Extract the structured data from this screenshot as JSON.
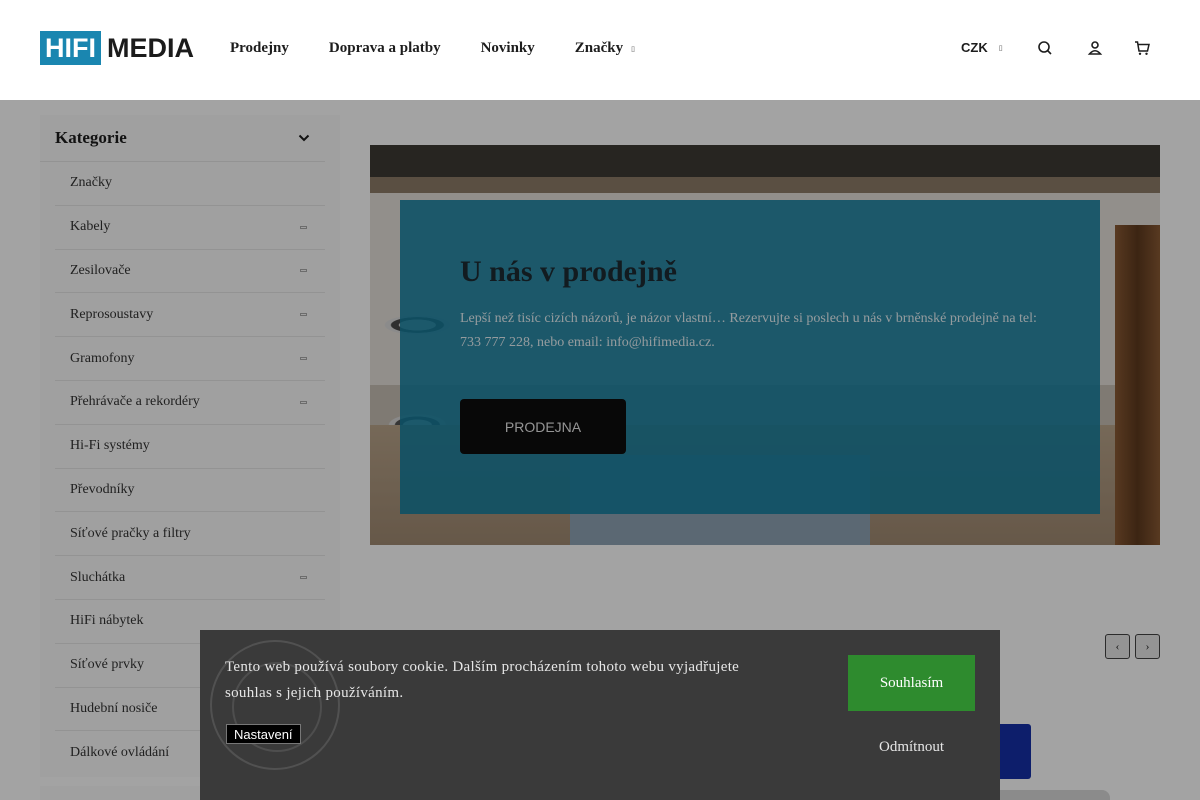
{
  "header": {
    "logo": {
      "box_text": "HIFI",
      "text": "MEDIA"
    },
    "nav": [
      {
        "label": "Prodejny"
      },
      {
        "label": "Doprava a platby"
      },
      {
        "label": "Novinky"
      },
      {
        "label": "Značky",
        "has_dropdown": true
      }
    ],
    "currency": "CZK",
    "icons": [
      "search-icon",
      "user-icon",
      "cart-icon"
    ]
  },
  "sidebar": {
    "title": "Kategorie",
    "items": [
      {
        "label": "Značky",
        "expandable": false
      },
      {
        "label": "Kabely",
        "expandable": true
      },
      {
        "label": "Zesilovače",
        "expandable": true
      },
      {
        "label": "Reprosoustavy",
        "expandable": true
      },
      {
        "label": "Gramofony",
        "expandable": true
      },
      {
        "label": "Přehrávače a rekordéry",
        "expandable": true
      },
      {
        "label": "Hi-Fi systémy",
        "expandable": false
      },
      {
        "label": "Převodníky",
        "expandable": false
      },
      {
        "label": "Síťové pračky a filtry",
        "expandable": false
      },
      {
        "label": "Sluchátka",
        "expandable": true
      },
      {
        "label": "HiFi nábytek",
        "expandable": false
      },
      {
        "label": "Síťové prvky",
        "expandable": false
      },
      {
        "label": "Hudební nosiče",
        "expandable": false
      },
      {
        "label": "Dálkové ovládání",
        "expandable": false
      }
    ]
  },
  "banner": {
    "title": "U nás v prodejně",
    "text": "Lepší než tisíc cizích názorů, je názor vlastní… Rezervujte si poslech u nás v brněnské prodejně na tel: 733 777 228, nebo email: info@hifimedia.cz.",
    "button": "PRODEJNA"
  },
  "carousel": {
    "prev_icon": "chevron-left-icon",
    "next_icon": "chevron-right-icon"
  },
  "cookie": {
    "text": "Tento web používá soubory cookie. Dalším procházením tohoto webu vyjadřujete souhlas s jejich používáním.",
    "settings_label": "Nastavení",
    "accept_label": "Souhlasím",
    "decline_label": "Odmítnout"
  },
  "colors": {
    "brand": "#1a86b0",
    "overlay": "#127d9e",
    "accept": "#2e8b2e"
  }
}
